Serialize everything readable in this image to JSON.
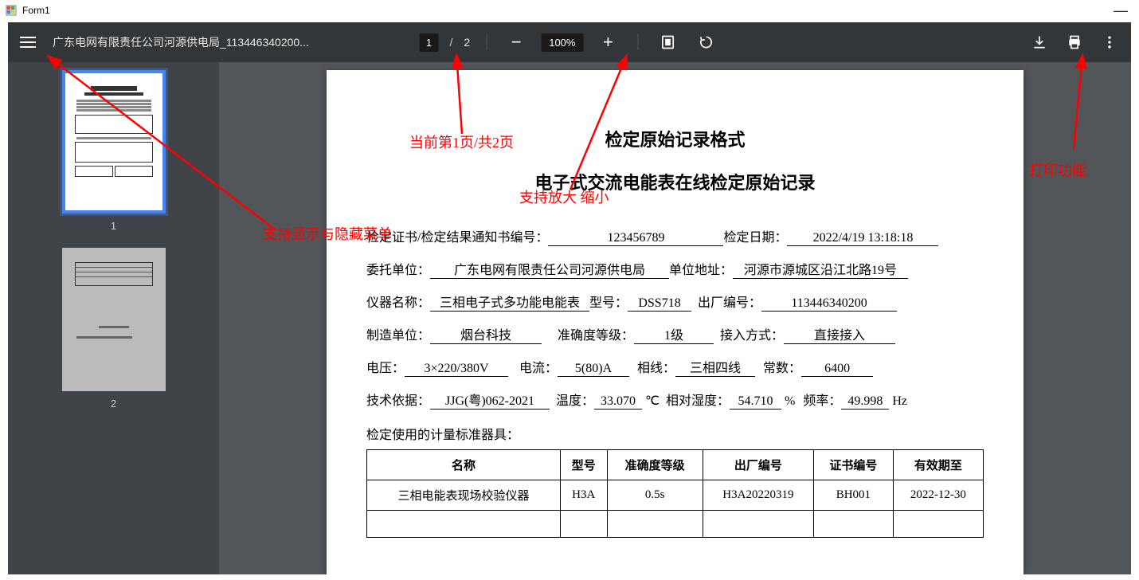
{
  "window": {
    "title": "Form1",
    "minimize": "—"
  },
  "toolbar": {
    "filename": "广东电网有限责任公司河源供电局_113446340200...",
    "page_current": "1",
    "page_sep": "/",
    "page_total": "2",
    "zoom": "100%"
  },
  "annotations": {
    "menu": "支持显示与隐藏菜单",
    "pages": "当前第1页/共2页",
    "zoom": "支持放大 缩小",
    "print": "打印功能"
  },
  "thumbnails": [
    {
      "label": "1",
      "selected": true
    },
    {
      "label": "2",
      "selected": false
    }
  ],
  "doc": {
    "title": "检定原始记录格式",
    "subtitle": "电子式交流电能表在线检定原始记录",
    "row1": {
      "label_cert": "检定证书/检定结果通知书编号：",
      "cert_no": "123456789",
      "label_date": "检定日期：",
      "date": "2022/4/19 13:18:18"
    },
    "row2": {
      "label_client": "委托单位：",
      "client": "广东电网有限责任公司河源供电局",
      "label_addr": "单位地址：",
      "addr": "河源市源城区沿江北路19号"
    },
    "row3": {
      "label_name": "仪器名称：",
      "name": "三相电子式多功能电能表",
      "label_model": "型号：",
      "model": "DSS718",
      "label_serial": "出厂编号：",
      "serial": "113446340200"
    },
    "row4": {
      "label_maker": "制造单位：",
      "maker": "烟台科技",
      "label_class": "准确度等级：",
      "class": "1级",
      "label_conn": "接入方式：",
      "conn": "直接接入"
    },
    "row5": {
      "label_volt": "电压：",
      "volt": "3×220/380V",
      "label_curr": "电流：",
      "curr": "5(80)A",
      "label_phase": "相线：",
      "phase": "三相四线",
      "label_const": "常数：",
      "const": "6400"
    },
    "row6": {
      "label_basis": "技术依据：",
      "basis": "JJG(粤)062-2021",
      "label_temp": "温度：",
      "temp": "33.070",
      "temp_unit": "℃",
      "label_hum": "相对湿度：",
      "hum": "54.710",
      "hum_unit": "%",
      "label_freq": "频率：",
      "freq": "49.998",
      "freq_unit": "Hz"
    },
    "section_label": "检定使用的计量标准器具：",
    "table": {
      "headers": [
        "名称",
        "型号",
        "准确度等级",
        "出厂编号",
        "证书编号",
        "有效期至"
      ],
      "rows": [
        [
          "三相电能表现场校验仪器",
          "H3A",
          "0.5s",
          "H3A20220319",
          "BH001",
          "2022-12-30"
        ]
      ]
    }
  }
}
